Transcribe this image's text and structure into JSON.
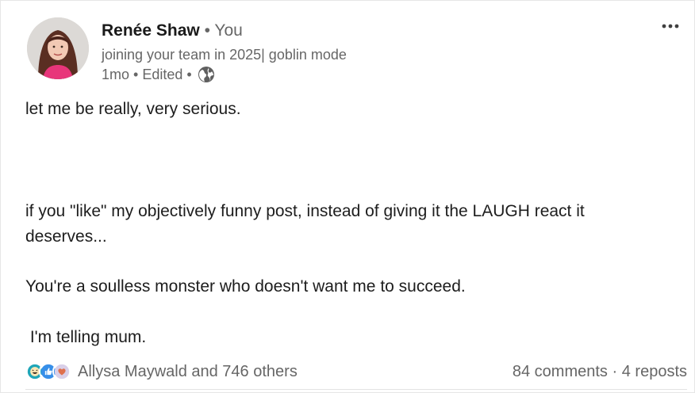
{
  "author": {
    "name": "Renée Shaw",
    "separator": "•",
    "relation": "You",
    "headline": "joining your team in 2025| goblin mode",
    "time": "1mo",
    "edited": "Edited",
    "visibility_icon": "globe-icon"
  },
  "post": {
    "lines": [
      "let me be really, very serious.",
      "if you \"like\" my objectively funny post, instead of giving it the LAUGH react it",
      "deserves...",
      "You're a soulless monster who doesn't want me to succeed.",
      " I'm telling mum."
    ]
  },
  "social": {
    "reaction_icons": [
      "laugh-reaction-icon",
      "like-reaction-icon",
      "love-reaction-icon"
    ],
    "reactors": "Allysa Maywald and 746 others",
    "comments": "84 comments",
    "dot": "·",
    "reposts": "4 reposts"
  },
  "colors": {
    "secondary_text": "#666666",
    "like_blue": "#378fe9",
    "laugh_teal": "#1fa6b8",
    "love_red": "#df704d"
  }
}
